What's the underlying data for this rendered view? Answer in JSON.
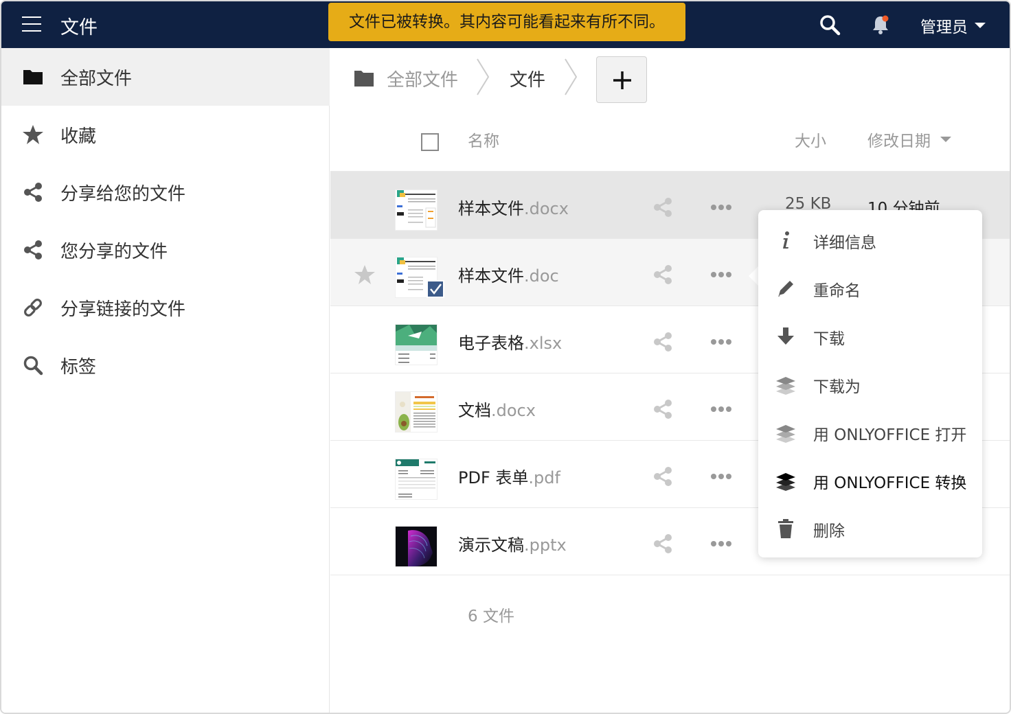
{
  "header": {
    "title": "文件",
    "toast": "文件已被转换。其内容可能看起来有所不同。",
    "user": "管理员",
    "colors": {
      "bar": "#0f2142",
      "toast": "#e6ac17",
      "notification_dot": "#f05a28"
    }
  },
  "sidebar": {
    "items": [
      {
        "label": "全部文件",
        "icon": "folder-icon",
        "active": true
      },
      {
        "label": "收藏",
        "icon": "star-icon"
      },
      {
        "label": "分享给您的文件",
        "icon": "share-icon"
      },
      {
        "label": "您分享的文件",
        "icon": "share-icon"
      },
      {
        "label": "分享链接的文件",
        "icon": "link-icon"
      },
      {
        "label": "标签",
        "icon": "search-icon"
      }
    ]
  },
  "breadcrumb": {
    "items": [
      "全部文件",
      "文件"
    ],
    "add_label": "+"
  },
  "table": {
    "columns": {
      "name": "名称",
      "size": "大小",
      "date": "修改日期"
    },
    "rows": [
      {
        "name": "样本文件",
        "ext": ".docx",
        "size": "25 KB",
        "date": "10 分钟前",
        "thumb": "doc"
      },
      {
        "name": "样本文件",
        "ext": ".doc",
        "size": "",
        "date": "",
        "thumb": "doc",
        "starred": true,
        "checked": true
      },
      {
        "name": "电子表格",
        "ext": ".xlsx",
        "size": "",
        "date": "",
        "thumb": "xlsx"
      },
      {
        "name": "文档",
        "ext": ".docx",
        "size": "",
        "date": "",
        "thumb": "avocado"
      },
      {
        "name": "PDF 表单",
        "ext": ".pdf",
        "size": "",
        "date": "",
        "thumb": "pdf"
      },
      {
        "name": "演示文稿",
        "ext": ".pptx",
        "size": "",
        "date": "",
        "thumb": "pptx"
      }
    ],
    "summary": "6 文件"
  },
  "context_menu": {
    "items": [
      {
        "label": "详细信息",
        "icon": "info-icon"
      },
      {
        "label": "重命名",
        "icon": "pencil-icon"
      },
      {
        "label": "下载",
        "icon": "download-icon"
      },
      {
        "label": "下载为",
        "icon": "layers-icon"
      },
      {
        "label": "用 ONLYOFFICE 打开",
        "icon": "layers-icon"
      },
      {
        "label": "用 ONLYOFFICE 转换",
        "icon": "layers-icon",
        "emphasis": true
      },
      {
        "label": "删除",
        "icon": "trash-icon"
      }
    ]
  }
}
